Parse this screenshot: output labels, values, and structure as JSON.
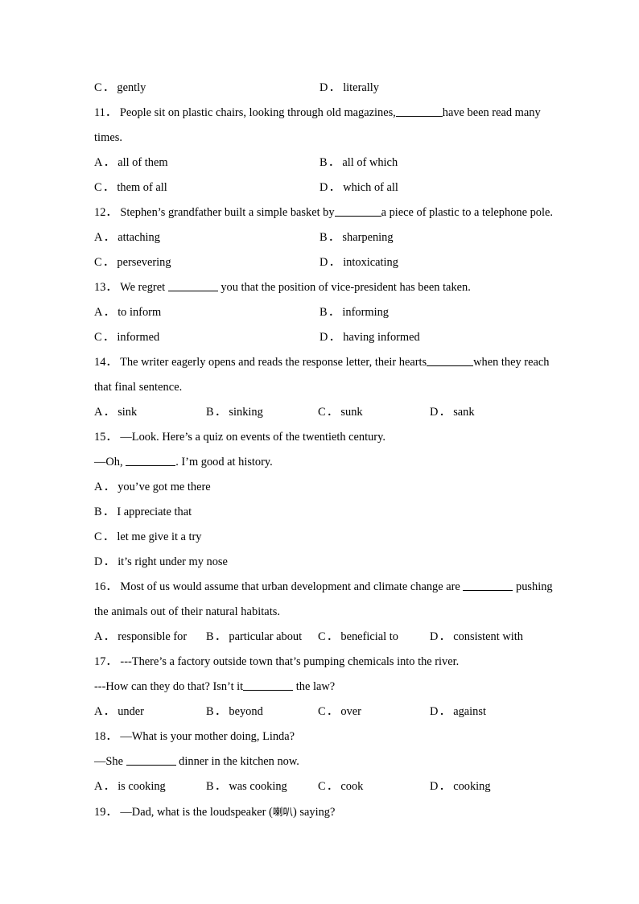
{
  "document": {
    "type": "english-exam-worksheet",
    "page_background": "#ffffff",
    "text_color": "#000000"
  },
  "carryover_options": {
    "c_label": "C",
    "c_text": "gently",
    "d_label": "D",
    "d_text": "literally"
  },
  "questions": [
    {
      "number": "11．",
      "stem_before": "People sit on plastic chairs, looking through old magazines,",
      "stem_after": "have been read many",
      "stem_line2": "times.",
      "layout": "two-column",
      "options": [
        {
          "label": "A",
          "text": "all of them"
        },
        {
          "label": "B",
          "text": "all of which"
        },
        {
          "label": "C",
          "text": "them of all"
        },
        {
          "label": "D",
          "text": "which of all"
        }
      ]
    },
    {
      "number": "12．",
      "stem_before": "Stephen’s grandfather built a simple basket by",
      "stem_after": "a piece of plastic to a telephone pole.",
      "layout": "two-column",
      "options": [
        {
          "label": "A",
          "text": "attaching"
        },
        {
          "label": "B",
          "text": "sharpening"
        },
        {
          "label": "C",
          "text": "persevering"
        },
        {
          "label": "D",
          "text": "intoxicating"
        }
      ]
    },
    {
      "number": "13．",
      "stem_before": "We regret ",
      "stem_after": " you that the position of vice-president has been taken.",
      "layout": "two-column",
      "options": [
        {
          "label": "A",
          "text": "to inform"
        },
        {
          "label": "B",
          "text": "informing"
        },
        {
          "label": "C",
          "text": "informed"
        },
        {
          "label": "D",
          "text": "having informed"
        }
      ]
    },
    {
      "number": "14．",
      "stem_before": "The writer eagerly opens and reads the response letter, their hearts",
      "stem_after": "when they reach",
      "stem_line2": "that final sentence.",
      "layout": "four-column",
      "options": [
        {
          "label": "A",
          "text": "sink"
        },
        {
          "label": "B",
          "text": "sinking"
        },
        {
          "label": "C",
          "text": "sunk"
        },
        {
          "label": "D",
          "text": "sank"
        }
      ]
    },
    {
      "number": "15．",
      "dialogue_line1": "—Look. Here’s a quiz on events of the twentieth century.",
      "dialogue_line2_before": "—Oh, ",
      "dialogue_line2_after": ". I’m good at history.",
      "layout": "stacked",
      "options": [
        {
          "label": "A",
          "text": "you’ve got me there"
        },
        {
          "label": "B",
          "text": "I appreciate that"
        },
        {
          "label": "C",
          "text": "let me give it a try"
        },
        {
          "label": "D",
          "text": "it’s right under my nose"
        }
      ]
    },
    {
      "number": "16．",
      "stem_before": "Most of us would assume that urban development and climate change are ",
      "stem_after": " pushing",
      "stem_line2": "the animals out of their natural habitats.",
      "layout": "four-column",
      "options": [
        {
          "label": "A",
          "text": "responsible for"
        },
        {
          "label": "B",
          "text": "particular about"
        },
        {
          "label": "C",
          "text": "beneficial to"
        },
        {
          "label": "D",
          "text": "consistent with"
        }
      ]
    },
    {
      "number": "17．",
      "dialogue_line1": "---There’s a factory outside town that’s pumping chemicals into the river.",
      "dialogue_line2_before": "---How can they do that? Isn’t it",
      "dialogue_line2_after": " the law?",
      "layout": "four-column",
      "options": [
        {
          "label": "A",
          "text": "under"
        },
        {
          "label": "B",
          "text": "beyond"
        },
        {
          "label": "C",
          "text": "over"
        },
        {
          "label": "D",
          "text": "against"
        }
      ]
    },
    {
      "number": "18．",
      "dialogue_line1": "—What is your mother doing, Linda?",
      "dialogue_line2_before": "—She ",
      "dialogue_line2_after": " dinner in the kitchen now.",
      "layout": "four-column",
      "options": [
        {
          "label": "A",
          "text": "is cooking"
        },
        {
          "label": "B",
          "text": "was cooking"
        },
        {
          "label": "C",
          "text": "cook"
        },
        {
          "label": "D",
          "text": "cooking"
        }
      ]
    },
    {
      "number": "19．",
      "dialogue_line1_a": "—Dad, what is the loudspeaker (",
      "dialogue_line1_zh": "喇叭",
      "dialogue_line1_b": ") saying?"
    }
  ]
}
